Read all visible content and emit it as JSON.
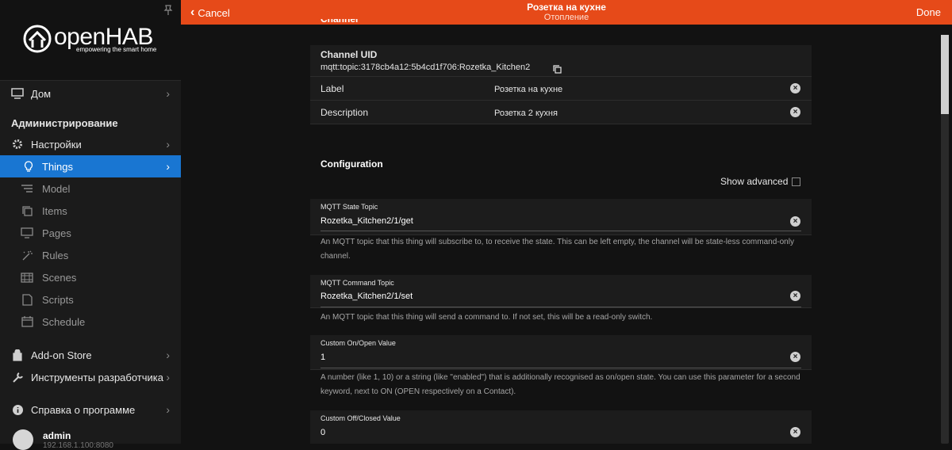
{
  "sidebar": {
    "logo_text": "openHAB",
    "logo_tagline": "empowering the smart home",
    "home_label": "Дом",
    "admin_heading": "Администрирование",
    "settings_label": "Настройки",
    "items": [
      {
        "label": "Things"
      },
      {
        "label": "Model"
      },
      {
        "label": "Items"
      },
      {
        "label": "Pages"
      },
      {
        "label": "Rules"
      },
      {
        "label": "Scenes"
      },
      {
        "label": "Scripts"
      },
      {
        "label": "Schedule"
      }
    ],
    "addon_label": "Add-on Store",
    "devtools_label": "Инструменты разработчика",
    "help_label": "Справка о программе",
    "user_name": "admin",
    "user_sub": "192.168.1.100:8080"
  },
  "topbar": {
    "cancel": "Cancel",
    "title": "Розетка на кухне",
    "subtitle": "Отопление",
    "done": "Done"
  },
  "channel": {
    "section_title": "Channel",
    "uid_label": "Channel UID",
    "uid_value": "mqtt:topic:3178cb4a12:5b4cd1f706:Rozetka_Kitchen2",
    "label_key": "Label",
    "label_value": "Розетка на кухне",
    "description_key": "Description",
    "description_value": "Розетка 2 кухня"
  },
  "config": {
    "title": "Configuration",
    "show_advanced": "Show advanced",
    "fields": [
      {
        "label": "MQTT State Topic",
        "value": "Rozetka_Kitchen2/1/get",
        "help": "An MQTT topic that this thing will subscribe to, to receive the state. This can be left empty, the channel will be state-less command-only channel."
      },
      {
        "label": "MQTT Command Topic",
        "value": "Rozetka_Kitchen2/1/set",
        "help": "An MQTT topic that this thing will send a command to. If not set, this will be a read-only switch."
      },
      {
        "label": "Custom On/Open Value",
        "value": "1",
        "help": "A number (like 1, 10) or a string (like \"enabled\") that is additionally recognised as on/open state. You can use this parameter for a second keyword, next to ON (OPEN respectively on a Contact)."
      },
      {
        "label": "Custom Off/Closed Value",
        "value": "0",
        "help": ""
      }
    ]
  }
}
